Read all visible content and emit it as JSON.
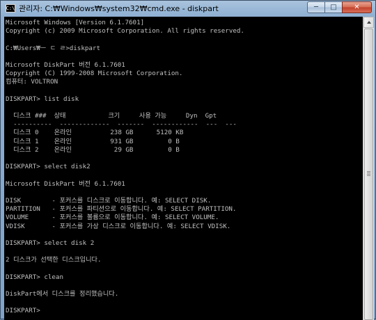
{
  "window": {
    "title": "관리자: C:₩Windows₩system32₩cmd.exe - diskpart",
    "icon": "console-icon",
    "icon_glyph": "C:\\",
    "buttons": {
      "minimize": "─",
      "maximize": "□",
      "close": "✕"
    }
  },
  "console": {
    "text_color": "#c0c0c0",
    "background": "#000000",
    "lines": [
      "Microsoft Windows [Version 6.1.7601]",
      "Copyright (c) 2009 Microsoft Corporation. All rights reserved.",
      "",
      "C:₩Users₩ㅡ ㄷ ㄹ>diskpart",
      "",
      "Microsoft DiskPart 버전 6.1.7601",
      "Copyright (C) 1999-2008 Microsoft Corporation.",
      "컴퓨터: VOLTRON",
      "",
      "DISKPART> list disk",
      "",
      "  디스크 ###  상태           크기     사용 가능     Dyn  Gpt",
      "  ----------  -------------  -------  ------------  ---  ---",
      "  디스크 0    온라인          238 GB      5120 KB",
      "  디스크 1    온라인          931 GB         0 B",
      "  디스크 2    온라인           29 GB         0 B",
      "",
      "DISKPART> select disk2",
      "",
      "Microsoft DiskPart 버전 6.1.7601",
      "",
      "DISK        - 포커스를 디스크로 이동합니다. 예: SELECT DISK.",
      "PARTITION   - 포커스를 파티션으로 이동합니다. 예: SELECT PARTITION.",
      "VOLUME      - 포커스를 볼륨으로 이동합니다. 예: SELECT VOLUME.",
      "VDISK       - 포커스를 가상 디스크로 이동합니다. 예: SELECT VDISK.",
      "",
      "DISKPART> select disk 2",
      "",
      "2 디스크가 선택한 디스크입니다.",
      "",
      "DISKPART> clean",
      "",
      "DiskPart에서 디스크를 정리했습니다.",
      "",
      "DISKPART> "
    ]
  },
  "scrollbar": {
    "up_arrow_icon": "arrow-up-icon"
  }
}
